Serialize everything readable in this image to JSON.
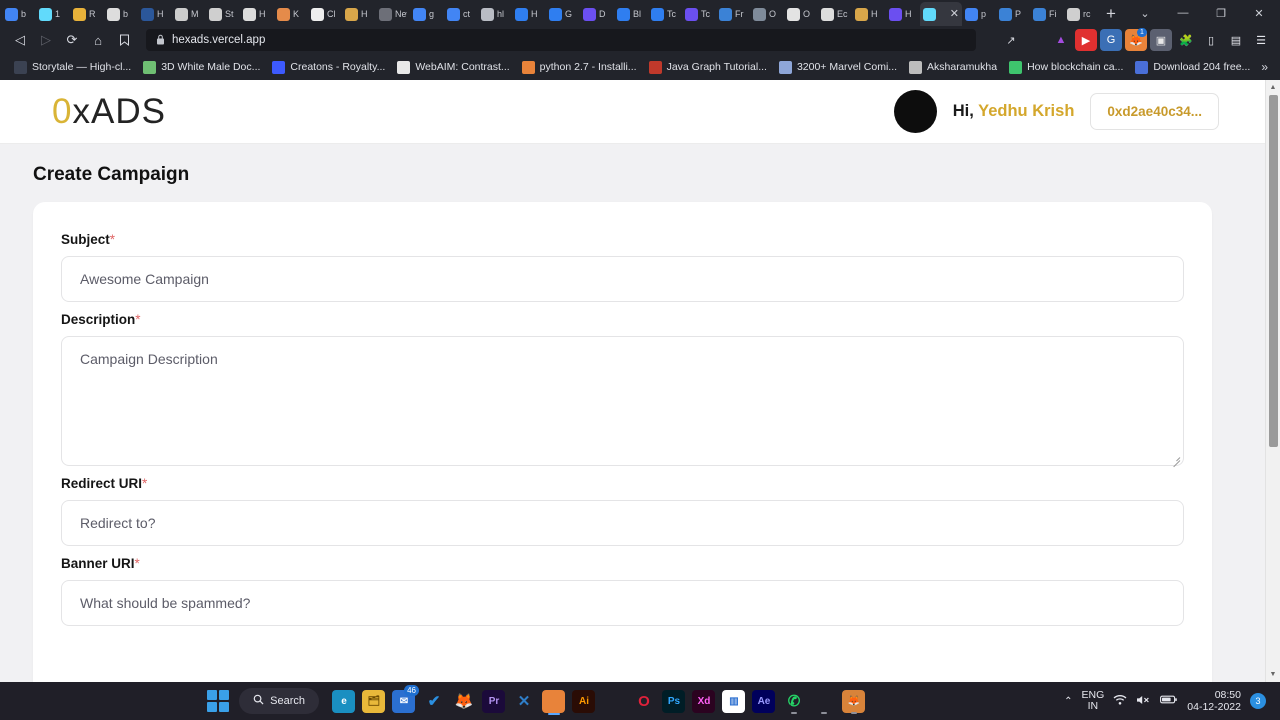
{
  "browser": {
    "nav": {
      "back": "◁",
      "forward": "▷",
      "reload": "⟳",
      "home": "⌂",
      "bookmark": "🔖"
    },
    "url": "hexads.vercel.app",
    "lock_icon": "lock-icon",
    "new_tab_label": "+",
    "window_controls": {
      "chevron": "⌄",
      "minimize": "—",
      "maximize": "❐",
      "close": "✕"
    },
    "tabs": [
      {
        "label": "b",
        "favicon": "google-icon",
        "color": "#4285f4",
        "active": false
      },
      {
        "label": "1",
        "favicon": "react-icon",
        "color": "#61dafb",
        "active": false
      },
      {
        "label": "R",
        "favicon": "book-icon",
        "color": "#e8b23a",
        "active": false
      },
      {
        "label": "b",
        "favicon": "github-icon",
        "color": "#dddddd",
        "active": false
      },
      {
        "label": "H",
        "favicon": "word-icon",
        "color": "#2b579a",
        "active": false
      },
      {
        "label": "M",
        "favicon": "medium-icon",
        "color": "#cccccc",
        "active": false
      },
      {
        "label": "St",
        "favicon": "globe-icon",
        "color": "#cfcfcf",
        "active": false
      },
      {
        "label": "H",
        "favicon": "ipfs-icon",
        "color": "#dcdcdc",
        "active": false
      },
      {
        "label": "K",
        "favicon": "kaggle-icon",
        "color": "#e58b4a",
        "active": false
      },
      {
        "label": "Cl",
        "favicon": "threejs-icon",
        "color": "#eeeeee",
        "active": false
      },
      {
        "label": "H",
        "favicon": "python-icon",
        "color": "#d8a64a",
        "active": false
      },
      {
        "label": "New T",
        "favicon": "newtab-icon",
        "color": "#6d6f78",
        "active": false
      },
      {
        "label": "g",
        "favicon": "google-icon",
        "color": "#4285f4",
        "active": false
      },
      {
        "label": "ct",
        "favicon": "google-icon",
        "color": "#4285f4",
        "active": false
      },
      {
        "label": "hl",
        "favicon": "fish-icon",
        "color": "#b9bcc4",
        "active": false
      },
      {
        "label": "H",
        "favicon": "c-icon",
        "color": "#2f7ef0",
        "active": false
      },
      {
        "label": "G",
        "favicon": "c-icon",
        "color": "#2f7ef0",
        "active": false
      },
      {
        "label": "D",
        "favicon": "c-icon",
        "color": "#6b4ff0",
        "active": false
      },
      {
        "label": "Bl",
        "favicon": "c-icon",
        "color": "#2f7ef0",
        "active": false
      },
      {
        "label": "Tc",
        "favicon": "c-icon",
        "color": "#2f7ef0",
        "active": false
      },
      {
        "label": "Tc",
        "favicon": "c-icon",
        "color": "#6b4ff0",
        "active": false
      },
      {
        "label": "Fr",
        "favicon": "brave-icon",
        "color": "#3b82d6",
        "active": false
      },
      {
        "label": "O",
        "favicon": "comet-icon",
        "color": "#7f8b9a",
        "active": false
      },
      {
        "label": "O",
        "favicon": "dropbox-icon",
        "color": "#e3e3e3",
        "active": false
      },
      {
        "label": "Ec",
        "favicon": "github-icon",
        "color": "#dddddd",
        "active": false
      },
      {
        "label": "H",
        "favicon": "python-icon",
        "color": "#d8a64a",
        "active": false
      },
      {
        "label": "H",
        "favicon": "c-icon",
        "color": "#6b4ff0",
        "active": false
      },
      {
        "label": "",
        "favicon": "react-icon",
        "color": "#61dafb",
        "active": true
      },
      {
        "label": "p",
        "favicon": "google-icon",
        "color": "#4285f4",
        "active": false
      },
      {
        "label": "P",
        "favicon": "brave-icon",
        "color": "#3b82d6",
        "active": false
      },
      {
        "label": "Fi",
        "favicon": "brave-icon",
        "color": "#3b82d6",
        "active": false
      },
      {
        "label": "rc",
        "favicon": "globe-icon",
        "color": "#cfcfcf",
        "active": false
      }
    ],
    "toolbar_icons": [
      {
        "name": "share-icon",
        "glyph": "↗",
        "color": "#d6d8df",
        "bg": "transparent"
      },
      {
        "name": "brave-shields-icon",
        "glyph": "",
        "color": "#fb542b",
        "bg": "transparent"
      },
      {
        "name": "brave-rewards-icon",
        "glyph": "▲",
        "color": "#a44ce0",
        "bg": "transparent"
      },
      {
        "name": "youtube-extension-icon",
        "glyph": "▶",
        "color": "#ffffff",
        "bg": "#e03030"
      },
      {
        "name": "grammarly-extension-icon",
        "glyph": "G",
        "color": "#ffffff",
        "bg": "#3b6fb5"
      },
      {
        "name": "metamask-extension-icon",
        "glyph": "🦊",
        "color": "#ffffff",
        "bg": "#e8833a",
        "badge": "1"
      },
      {
        "name": "screenshot-extension-icon",
        "glyph": "▣",
        "color": "#e8e8e8",
        "bg": "#5b6070"
      },
      {
        "name": "extensions-puzzle-icon",
        "glyph": "🧩",
        "color": "#e4e6ec",
        "bg": "transparent"
      },
      {
        "name": "sidebar-icon",
        "glyph": "▯",
        "color": "#e4e6ec",
        "bg": "transparent"
      },
      {
        "name": "wallet-icon",
        "glyph": "▤",
        "color": "#e4e6ec",
        "bg": "transparent"
      },
      {
        "name": "menu-icon",
        "glyph": "☰",
        "color": "#e4e6ec",
        "bg": "transparent"
      }
    ],
    "bookmarks": [
      {
        "label": "Storytale — High-cl...",
        "icon": "storytale-icon",
        "color": "#3b4252"
      },
      {
        "label": "3D White Male Doc...",
        "icon": "3d-icon",
        "color": "#6fbf73"
      },
      {
        "label": "Creatons - Royalty...",
        "icon": "creatons-icon",
        "color": "#3d5afe"
      },
      {
        "label": "WebAIM: Contrast...",
        "icon": "webaim-icon",
        "color": "#e8e8e8"
      },
      {
        "label": "python 2.7 - Installi...",
        "icon": "stackoverflow-icon",
        "color": "#e8833a"
      },
      {
        "label": "Java Graph Tutorial...",
        "icon": "java-icon",
        "color": "#c0392b"
      },
      {
        "label": "3200+ Marvel Comi...",
        "icon": "marvel-icon",
        "color": "#8ea6d8"
      },
      {
        "label": "Aksharamukha",
        "icon": "aksharamukha-icon",
        "color": "#bdbdbd"
      },
      {
        "label": "How blockchain ca...",
        "icon": "telegram-icon",
        "color": "#3ec46d"
      },
      {
        "label": "Download 204 free...",
        "icon": "download-icon",
        "color": "#4a6fd8"
      }
    ],
    "bookmarks_overflow": "»"
  },
  "site": {
    "logo": {
      "zero": "0",
      "rest": "xADS"
    },
    "greeting_prefix": "Hi,",
    "user_name": "Yedhu Krish",
    "wallet_address": "0xd2ae40c34...",
    "page_title": "Create Campaign",
    "accent_color": "#d4a72c",
    "form": {
      "fields": [
        {
          "label": "Subject",
          "required": "*",
          "placeholder": "Awesome Campaign",
          "type": "text",
          "name": "subject"
        },
        {
          "label": "Description",
          "required": "*",
          "placeholder": "Campaign Description",
          "type": "textarea",
          "name": "description"
        },
        {
          "label": "Redirect URI",
          "required": "*",
          "placeholder": "Redirect to?",
          "type": "text",
          "name": "redirect-uri"
        },
        {
          "label": "Banner URI",
          "required": "*",
          "placeholder": "What should be spammed?",
          "type": "text",
          "name": "banner-uri"
        }
      ]
    }
  },
  "taskbar": {
    "search_placeholder": "Search",
    "search_icon": "search-icon",
    "start_icon": "windows-start-icon",
    "apps": [
      {
        "name": "edge",
        "glyph": "e",
        "bg": "#1a8fc1",
        "fg": "#ffffff",
        "state": ""
      },
      {
        "name": "file-explorer",
        "glyph": "🗂",
        "bg": "#e8b83a",
        "fg": "#6b4a00",
        "state": ""
      },
      {
        "name": "mail",
        "glyph": "✉",
        "bg": "#2b6fd0",
        "fg": "#ffffff",
        "state": "",
        "badge": "46"
      },
      {
        "name": "microsoft-todo",
        "glyph": "✔",
        "bg": "transparent",
        "fg": "#2b8fe0",
        "state": ""
      },
      {
        "name": "firefox",
        "glyph": "🦊",
        "bg": "transparent",
        "fg": "#e8833a",
        "state": ""
      },
      {
        "name": "adobe-premiere",
        "glyph": "Pr",
        "bg": "#1b0a3a",
        "fg": "#b392f0",
        "state": ""
      },
      {
        "name": "vs-code",
        "glyph": "✕",
        "bg": "transparent",
        "fg": "#2f7ec9",
        "state": ""
      },
      {
        "name": "brave-browser",
        "glyph": "",
        "bg": "#e8833a",
        "fg": "#ffffff",
        "state": "active"
      },
      {
        "name": "adobe-illustrator",
        "glyph": "Ai",
        "bg": "#2a0c05",
        "fg": "#ff9a00",
        "state": ""
      },
      {
        "name": "google-chrome",
        "glyph": "",
        "bg": "transparent",
        "fg": "#4285f4",
        "state": ""
      },
      {
        "name": "opera",
        "glyph": "O",
        "bg": "transparent",
        "fg": "#e0213a",
        "state": ""
      },
      {
        "name": "adobe-photoshop",
        "glyph": "Ps",
        "bg": "#001d26",
        "fg": "#31a8ff",
        "state": ""
      },
      {
        "name": "adobe-xd",
        "glyph": "Xd",
        "bg": "#2b0320",
        "fg": "#ff61f6",
        "state": ""
      },
      {
        "name": "app-window",
        "glyph": "▥",
        "bg": "#ffffff",
        "fg": "#2b6fd0",
        "state": ""
      },
      {
        "name": "adobe-after-effects",
        "glyph": "Ae",
        "bg": "#00005b",
        "fg": "#9999ff",
        "state": ""
      },
      {
        "name": "whatsapp",
        "glyph": "✆",
        "bg": "transparent",
        "fg": "#25d366",
        "state": "run"
      },
      {
        "name": "chrome-canary",
        "glyph": "",
        "bg": "transparent",
        "fg": "#4285f4",
        "state": "run"
      },
      {
        "name": "metamask",
        "glyph": "🦊",
        "bg": "#d8833a",
        "fg": "#ffffff",
        "state": "run"
      }
    ],
    "tray": {
      "chevron": "⌃",
      "language_line1": "ENG",
      "language_line2": "IN",
      "wifi_icon": "wifi-icon",
      "volume_icon": "volume-muted-icon",
      "battery_icon": "battery-icon",
      "time": "08:50",
      "date": "04-12-2022",
      "notification_count": "3"
    }
  }
}
